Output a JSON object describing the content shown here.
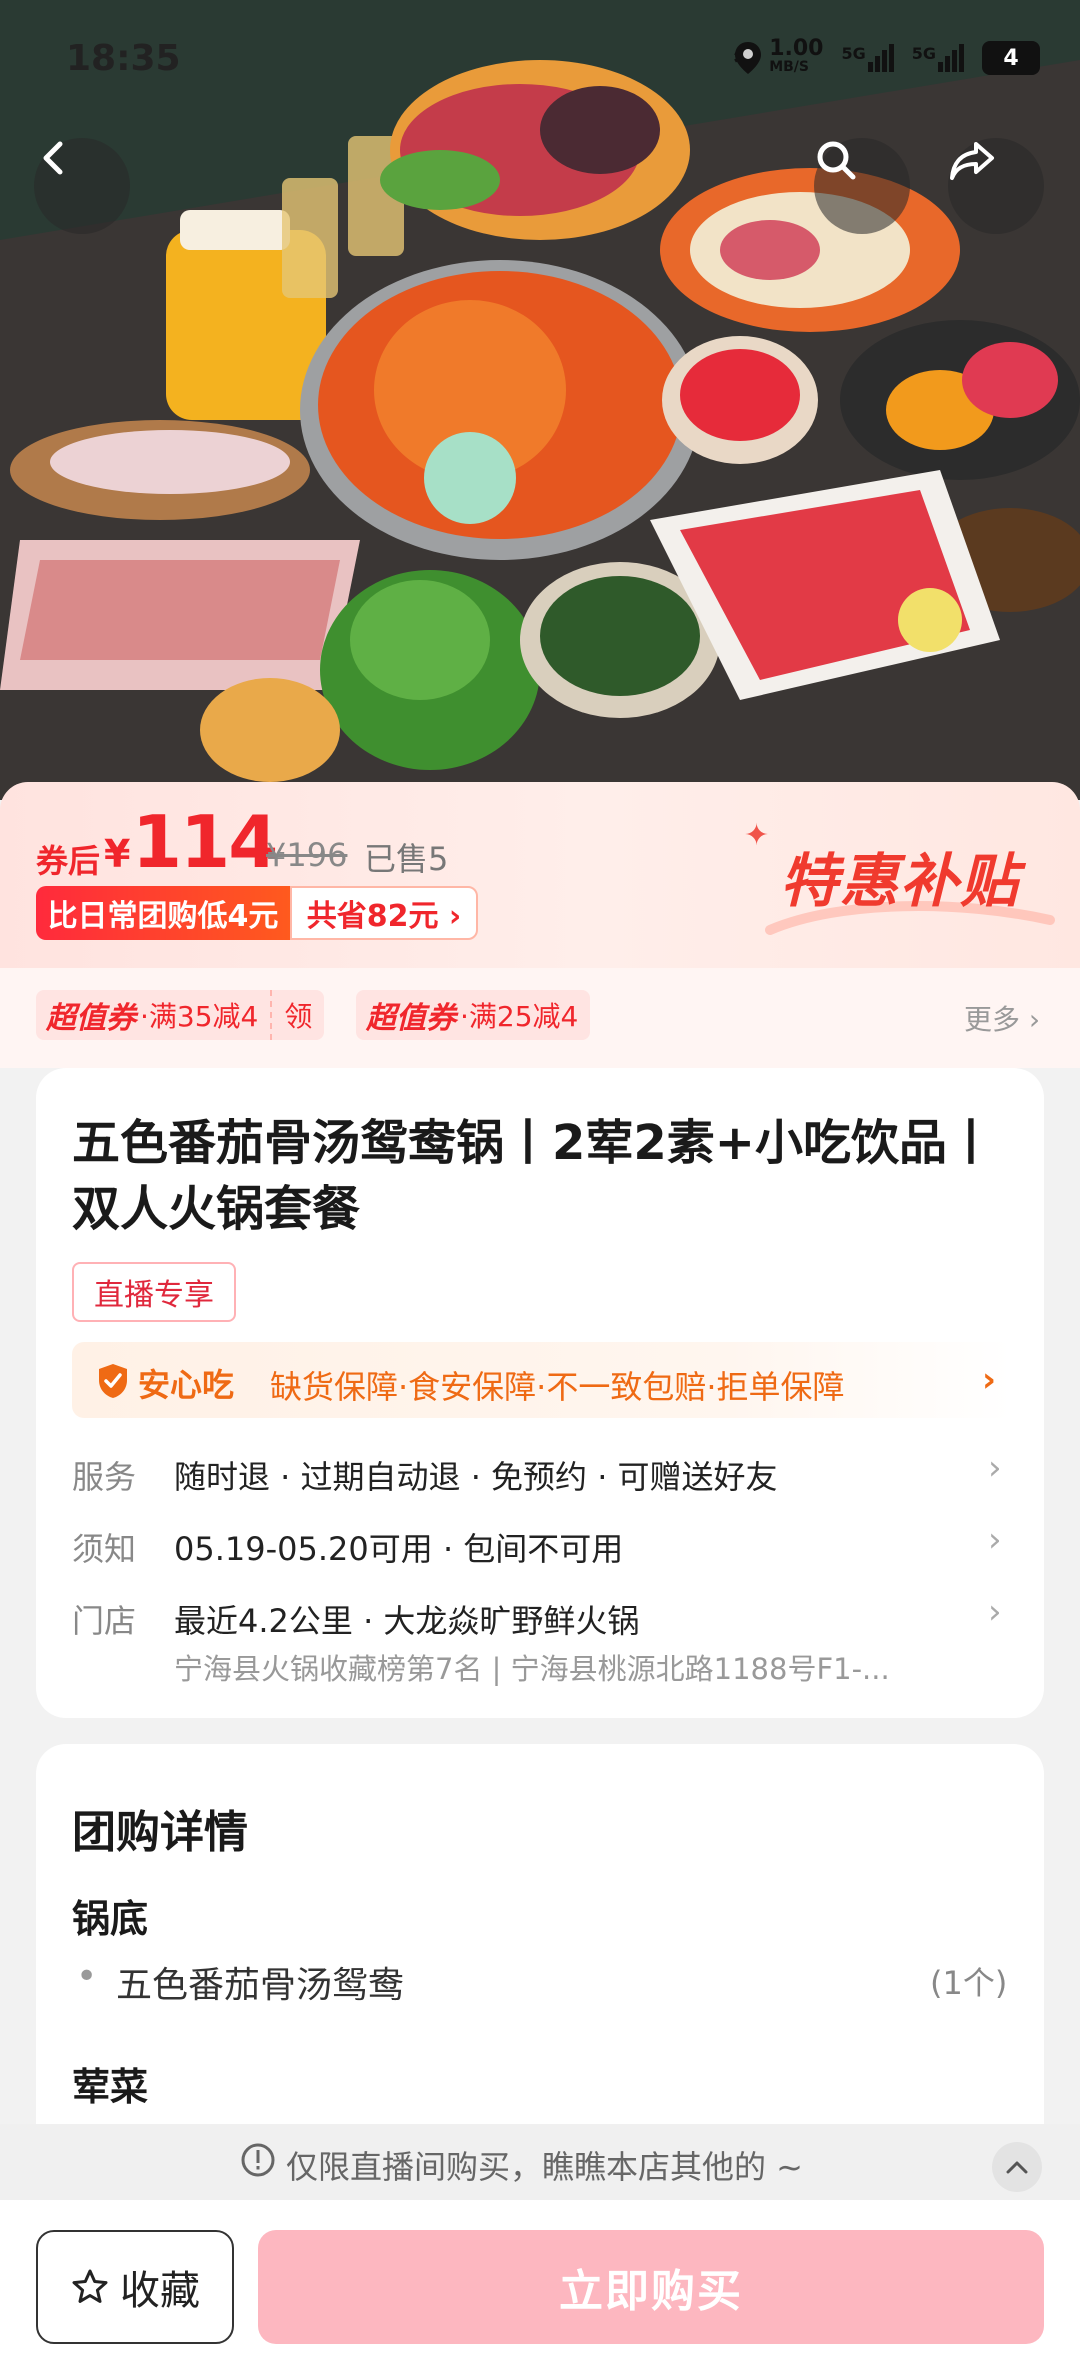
{
  "status_bar": {
    "time": "18:35",
    "net_speed": "1.00",
    "net_unit": "MB/S",
    "sim1": "5G",
    "sim2": "5G",
    "battery": "4"
  },
  "price": {
    "prefix": "券后",
    "currency": "¥",
    "value": "114",
    "original": "¥196",
    "sold": "已售5",
    "tag_lower": "比日常团购低4元",
    "tag_save": "共省82元 ›",
    "badge": "特惠补贴"
  },
  "coupons": [
    {
      "brand": "超值券",
      "desc": "·满35减4",
      "action": "领"
    },
    {
      "brand": "超值券",
      "desc": "·满25减4"
    }
  ],
  "more": "更多 ›",
  "product": {
    "title": "五色番茄骨汤鸳鸯锅丨2荤2素+小吃饮品丨双人火锅套餐",
    "live_tag": "直播专享",
    "safe_title": "安心吃",
    "safe_text": "缺货保障·食安保障·不一致包赔·拒单保障",
    "rows": [
      {
        "label": "服务",
        "value": "随时退 · 过期自动退 · 免预约 · 可赠送好友"
      },
      {
        "label": "须知",
        "value": "05.19-05.20可用 · 包间不可用"
      },
      {
        "label": "门店",
        "value": "最近4.2公里 · 大龙焱旷野鲜火锅",
        "sub": "宁海县火锅收藏榜第7名  |  宁海县桃源北路1188号F1-..."
      }
    ]
  },
  "details": {
    "heading": "团购详情",
    "section1": "锅底",
    "item1": "五色番茄骨汤鸳鸯",
    "item1_qty": "(1个)",
    "section2": "荤菜"
  },
  "notice": "仅限直播间购买，瞧瞧本店其他的 ~",
  "bottom": {
    "fav_label": "收藏",
    "buy_label": "立即购买"
  },
  "colors": {
    "accent": "#f0262c",
    "safe": "#ef6a14",
    "buy": "#fdb7c0"
  }
}
